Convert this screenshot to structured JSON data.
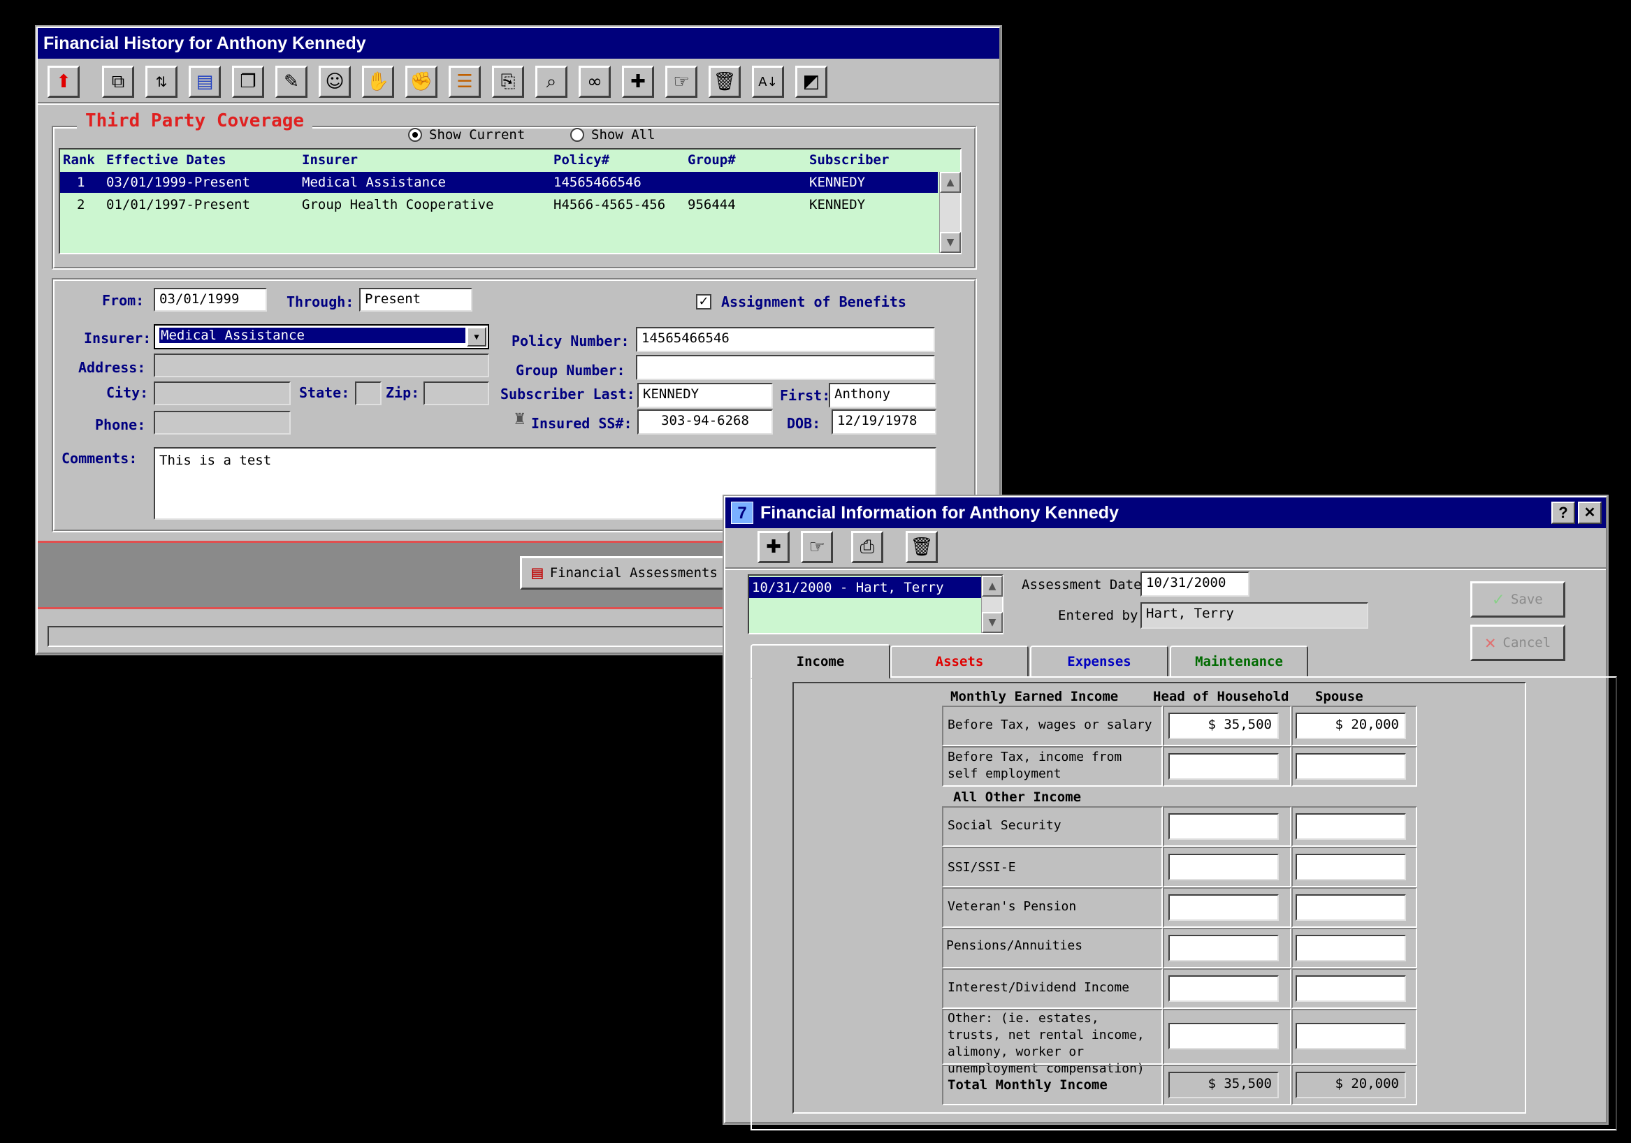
{
  "win1": {
    "title": "Financial History for Anthony Kennedy",
    "toolbar_icons": [
      "up-arrow-icon",
      "window-icon",
      "sort-icon",
      "page-icon",
      "copy-icon",
      "edit-icon",
      "people-icon",
      "hands-icon",
      "handshake-icon",
      "list-icon",
      "clipboard-icon",
      "preview-icon",
      "binoculars-icon",
      "new-record-icon",
      "hand-pointing-icon",
      "trash-icon",
      "sort-az-icon",
      "chart-icon"
    ],
    "section_title": "Third Party Coverage",
    "show_current": "Show Current",
    "show_all": "Show All",
    "columns": [
      "Rank",
      "Effective Dates",
      "Insurer",
      "Policy#",
      "Group#",
      "Subscriber"
    ],
    "rows": [
      {
        "rank": "1",
        "dates": "03/01/1999-Present",
        "insurer": "Medical Assistance",
        "policy": "14565466546",
        "group": "",
        "subscriber": "KENNEDY"
      },
      {
        "rank": "2",
        "dates": "01/01/1997-Present",
        "insurer": "Group Health Cooperative",
        "policy": "H4566-4565-456",
        "group": "956444",
        "subscriber": "KENNEDY"
      }
    ],
    "form": {
      "from_label": "From:",
      "from": "03/01/1999",
      "through_label": "Through:",
      "through": "Present",
      "aob": "Assignment of Benefits",
      "insurer_label": "Insurer:",
      "insurer": "Medical Assistance",
      "address_label": "Address:",
      "city_label": "City:",
      "state_label": "State:",
      "zip_label": "Zip:",
      "phone_label": "Phone:",
      "policy_label": "Policy Number:",
      "policy": "14565466546",
      "group_label": "Group Number:",
      "group": "",
      "sub_last_label": "Subscriber Last:",
      "sub_last": "KENNEDY",
      "first_label": "First:",
      "first": "Anthony",
      "ss_label": "Insured SS#:",
      "ss": "303-94-6268",
      "dob_label": "DOB:",
      "dob": "12/19/1978",
      "comments_label": "Comments:",
      "comments": "This is a test"
    },
    "fin_btn": "Financial Assessments"
  },
  "win2": {
    "title": "Financial Information for Anthony Kennedy",
    "title_icon": "7",
    "help": "?",
    "close": "✕",
    "list": [
      "10/31/2000 - Hart, Terry"
    ],
    "assess_label": "Assessment Date:",
    "assess": "10/31/2000",
    "entered_label": "Entered by:",
    "entered": "Hart, Terry",
    "save": "Save",
    "cancel": "Cancel",
    "tabs": [
      {
        "label": "Income",
        "color": "#000000"
      },
      {
        "label": "Assets",
        "color": "#e00000"
      },
      {
        "label": "Expenses",
        "color": "#0000c0"
      },
      {
        "label": "Maintenance",
        "color": "#006a00"
      }
    ],
    "hdr_income": "Monthly Earned Income",
    "hdr_head": "Head of Household",
    "hdr_spouse": "Spouse",
    "hdr_other": "All Other Income",
    "rows": [
      {
        "label": "Before Tax, wages or salary",
        "head": "$ 35,500",
        "spouse": "$ 20,000"
      },
      {
        "label": "Before Tax, income from self employment",
        "head": "",
        "spouse": ""
      },
      {
        "label": "Social Security",
        "head": "",
        "spouse": ""
      },
      {
        "label": "SSI/SSI-E",
        "head": "",
        "spouse": ""
      },
      {
        "label": "Veteran's Pension",
        "head": "",
        "spouse": ""
      },
      {
        "label": "Pensions/Annuities",
        "head": "",
        "spouse": ""
      },
      {
        "label": "Interest/Dividend Income",
        "head": "",
        "spouse": ""
      },
      {
        "label": "Other: (ie. estates, trusts, net rental income, alimony, worker or unemployment compensation)",
        "head": "",
        "spouse": ""
      }
    ],
    "total_label": "Total Monthly Income",
    "total_head": "$ 35,500",
    "total_spouse": "$ 20,000"
  }
}
